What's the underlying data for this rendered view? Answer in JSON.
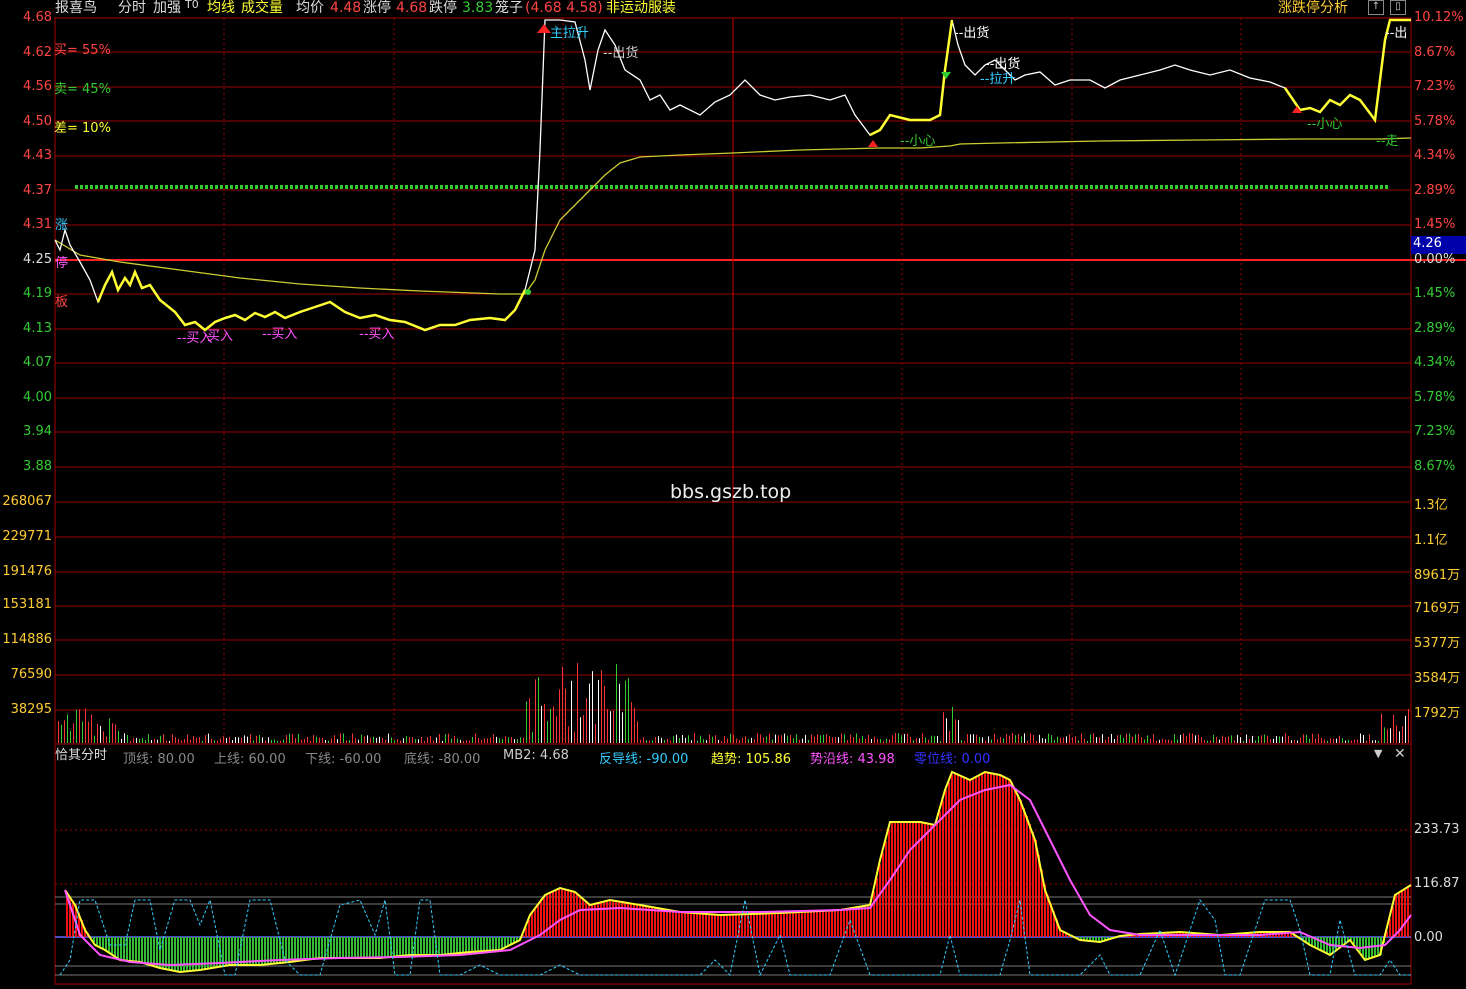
{
  "title_bar": {
    "stock_name": "报喜鸟",
    "tabs": [
      "分时",
      "加强"
    ],
    "badge": "T0",
    "avg_line": "均线",
    "volume": "成交量",
    "avg_price_label": "均价",
    "avg_price": "4.48",
    "limit_up_label": "涨停",
    "limit_up": "4.68",
    "limit_down_label": "跌停",
    "limit_down": "3.83",
    "cage_label": "笼子",
    "cage_value": "(4.68 4.58)",
    "sector": "非运动服装",
    "analysis_button": "涨跌停分析"
  },
  "watermark": "bbs.gszb.top",
  "price_axis": {
    "left": [
      "4.68",
      "4.62",
      "4.56",
      "4.50",
      "4.43",
      "4.37",
      "4.31",
      "4.25",
      "4.19",
      "4.13",
      "4.07",
      "4.00",
      "3.94",
      "3.88"
    ],
    "right": [
      "10.12%",
      "8.67%",
      "7.23%",
      "5.78%",
      "4.34%",
      "2.89%",
      "1.45%",
      "0.00%",
      "1.45%",
      "2.89%",
      "4.34%",
      "5.78%",
      "7.23%",
      "8.67%"
    ],
    "current_price_tag": "4.26"
  },
  "volume_axis": {
    "left": [
      "268067",
      "229771",
      "191476",
      "153181",
      "114886",
      "76590",
      "38295"
    ],
    "right": [
      "1.3亿",
      "1.1亿",
      "8961万",
      "7169万",
      "5377万",
      "3584万",
      "1792万"
    ]
  },
  "side_stats": {
    "buy": "买= 55%",
    "sell": "卖= 45%",
    "diff": "差= 10%",
    "limit_chars": [
      "涨",
      "停",
      "板"
    ]
  },
  "annotations": {
    "buy1": "--买入",
    "buy2": "买入",
    "buy3": "--买入",
    "buy4": "--买入",
    "main_lift": "主拉升",
    "ship1": "--出货",
    "careful1": "--小心",
    "ship2": "--出货",
    "ship3": "--出货",
    "lift": "--拉升",
    "careful2": "--小心",
    "ship4": "--出",
    "walk": "--走"
  },
  "indicator": {
    "name": "恰其分时",
    "items": [
      {
        "label": "顶线:",
        "value": "80.00",
        "color": "#888888"
      },
      {
        "label": "上线:",
        "value": "60.00",
        "color": "#888888"
      },
      {
        "label": "下线:",
        "value": "-60.00",
        "color": "#888888"
      },
      {
        "label": "底线:",
        "value": "-80.00",
        "color": "#888888"
      },
      {
        "label": "MB2:",
        "value": "4.68",
        "color": "#cccccc"
      },
      {
        "label": "反导线:",
        "value": "-90.00",
        "color": "#33ccff"
      },
      {
        "label": "趋势:",
        "value": "105.86",
        "color": "#ffff33"
      },
      {
        "label": "势沿线:",
        "value": "43.98",
        "color": "#ff55ff"
      },
      {
        "label": "零位线:",
        "value": "0.00",
        "color": "#3333ff"
      }
    ],
    "axis": [
      "233.73",
      "116.87",
      "0.00"
    ]
  }
}
